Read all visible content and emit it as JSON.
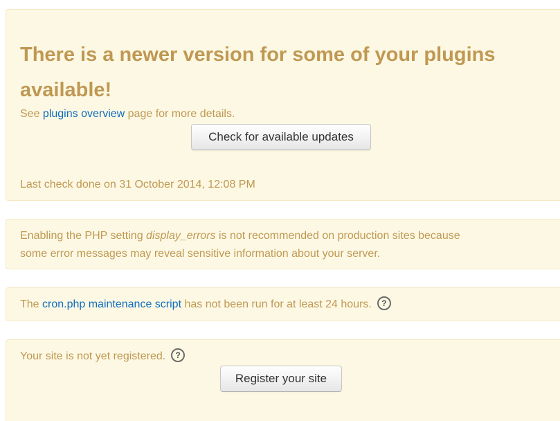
{
  "update_notice": {
    "heading": "There is a newer version for some of your plugins available!",
    "details_prefix": "See ",
    "details_link": "plugins overview",
    "details_suffix": " page for more details.",
    "check_button_label": "Check for available updates",
    "last_check_text": "Last check done on 31 October 2014, 12:08 PM"
  },
  "display_errors_notice": {
    "text_before": "Enabling the PHP setting ",
    "setting_name": "display_errors",
    "text_after_line1": " is not recommended on production sites because",
    "text_line2": "some error messages may reveal sensitive information about your server."
  },
  "cron_notice": {
    "text_before": "The ",
    "link_text": "cron.php maintenance script",
    "text_after": " has not been run for at least 24 hours.",
    "help_icon": "question-circle-icon"
  },
  "registration_notice": {
    "text": "Your site is not yet registered.",
    "help_icon": "question-circle-icon",
    "register_button_label": "Register your site"
  },
  "colors": {
    "notice_background": "#fcf8e3",
    "notice_text": "#c09853",
    "link": "#0f6cbf"
  }
}
